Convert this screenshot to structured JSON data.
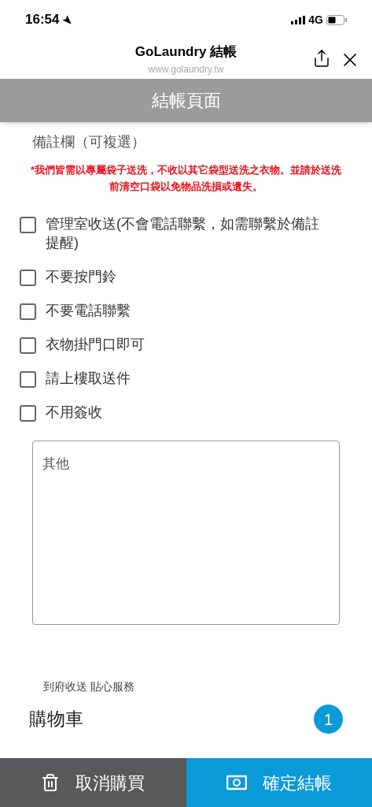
{
  "status_bar": {
    "time": "16:54",
    "network": "4G"
  },
  "browser_header": {
    "title": "GoLaundry 結帳",
    "url": "www.golaundry.tw"
  },
  "page_title": "結帳頁面",
  "notes": {
    "label": "備註欄（可複選）",
    "warning": "*我們皆需以專屬袋子送洗，不收以其它袋型送洗之衣物。並請於送洗前清空口袋以免物品洗損或遺失。",
    "options": [
      {
        "label": "管理室收送(不會電話聯繫，如需聯繫於備註提醒)",
        "checked": false
      },
      {
        "label": "不要按門鈴",
        "checked": false
      },
      {
        "label": "不要電話聯繫",
        "checked": false
      },
      {
        "label": "衣物掛門口即可",
        "checked": false
      },
      {
        "label": "請上樓取送件",
        "checked": false
      },
      {
        "label": "不用簽收",
        "checked": false
      }
    ],
    "other": {
      "placeholder": "其他"
    }
  },
  "tagline": "到府收送 貼心服務",
  "cart": {
    "title": "購物車",
    "count": "1"
  },
  "actions": [
    {
      "kind": "cancel",
      "label": "取消購買"
    },
    {
      "kind": "confirm",
      "label": "確定結帳"
    }
  ]
}
